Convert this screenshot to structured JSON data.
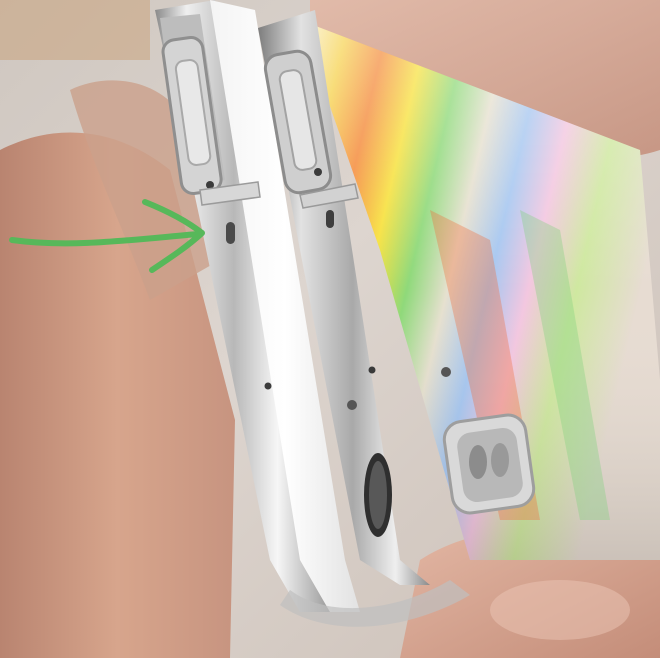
{
  "scene": {
    "subjects": [
      "phone-back",
      "phone-front",
      "hand",
      "annotation-arrow"
    ],
    "colors": {
      "background": "#d9d2cb",
      "skin": "#d7a58c",
      "chrome": "#c9c9c9",
      "arrow": "#57b85a",
      "holo_yellow": "#f7e13d",
      "holo_orange": "#f48a3a",
      "holo_green": "#8fd97a",
      "holo_blue": "#a7c7f0"
    }
  }
}
